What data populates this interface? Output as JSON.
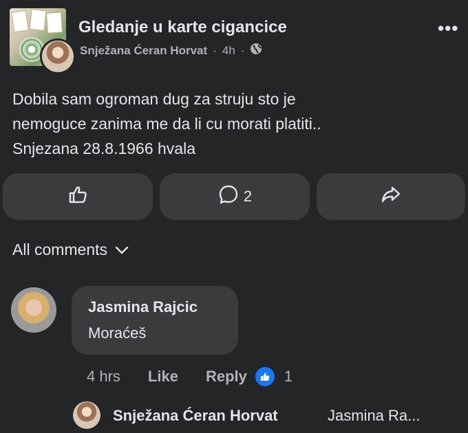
{
  "post": {
    "group_name": "Gledanje u karte cigancice",
    "author": "Snježana Ćeran Horvat",
    "separator": "·",
    "time": "4h",
    "privacy_icon": "globe-icon",
    "more_icon": "more-options-icon",
    "more_label": "•••",
    "text": "Dobila sam ogroman dug za struju sto je\nnemoguce zanima me da li cu morati platiti..\nSnjezana 28.8.1966 hvala"
  },
  "actions": {
    "like_icon": "thumbs-up-icon",
    "comment_icon": "comment-icon",
    "comment_count": "2",
    "share_icon": "share-icon"
  },
  "comments_header": {
    "label": "All comments",
    "icon": "chevron-down-icon"
  },
  "comment": {
    "author": "Jasmina Rajcic",
    "text": "Moraćeš",
    "time": "4 hrs",
    "like_label": "Like",
    "reply_label": "Reply",
    "reaction_icon": "like-reaction-icon",
    "reaction_color": "#1877f2",
    "reaction_count": "1"
  },
  "reply_preview": {
    "author": "Snježana Ćeran Horvat",
    "text": "Jasmina Ra..."
  }
}
